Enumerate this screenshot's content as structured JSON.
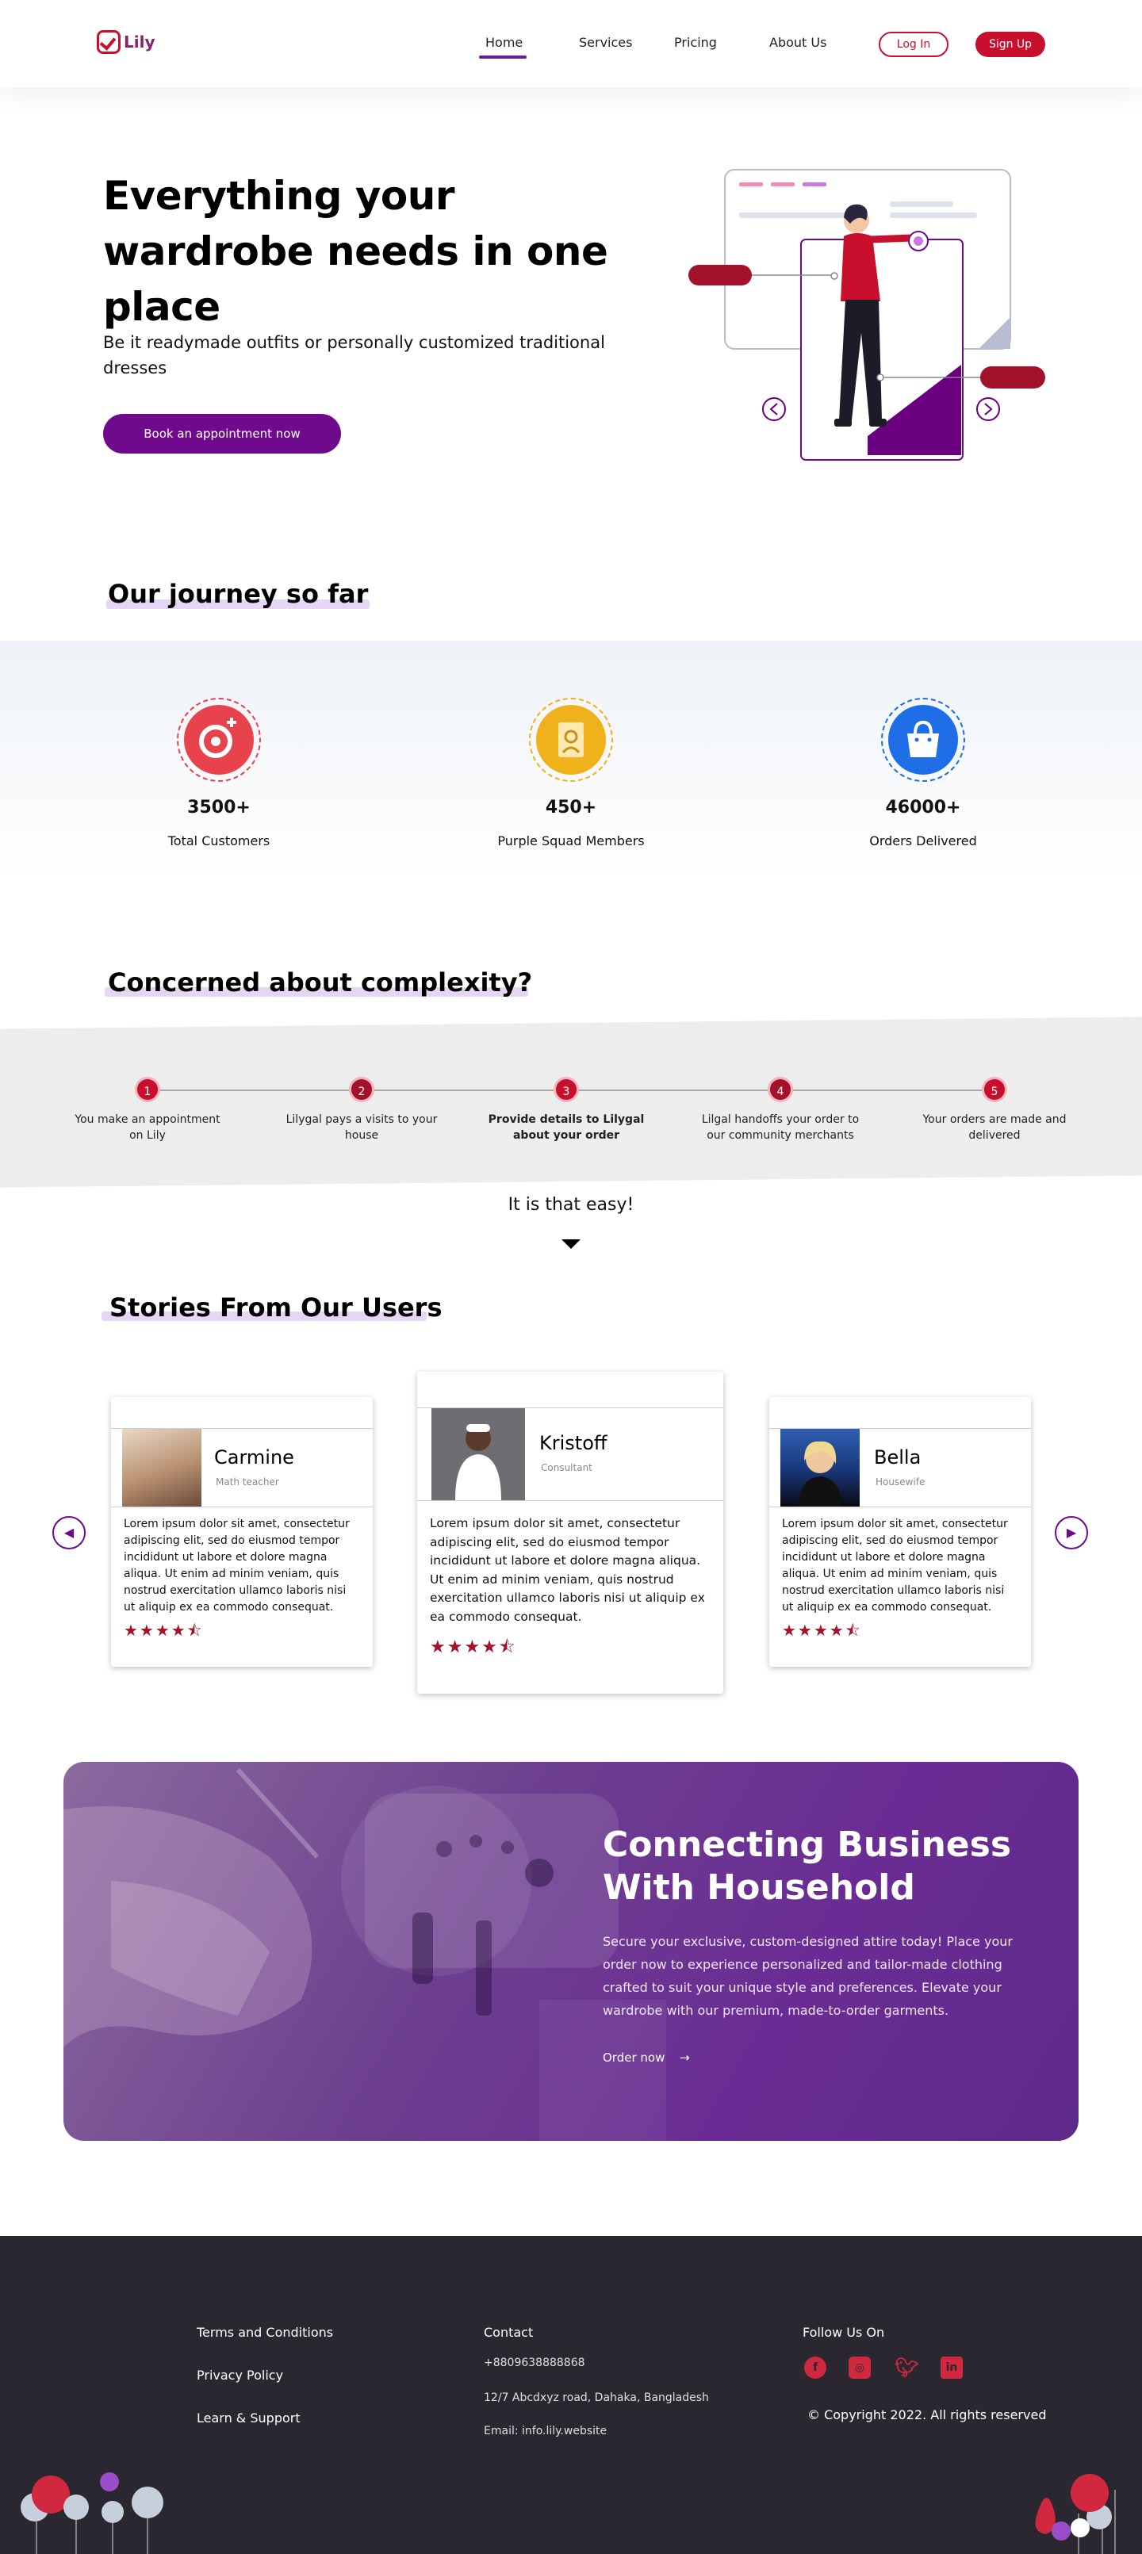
{
  "header": {
    "logo_text": "Lily",
    "nav": [
      "Home",
      "Services",
      "Pricing",
      "About Us"
    ],
    "login_label": "Log In",
    "signup_label": "Sign Up"
  },
  "hero": {
    "title": "Everything your wardrobe needs in one place",
    "subtitle": "Be it readymade outfits or personally customized traditional dresses",
    "cta_label": "Book an appointment now"
  },
  "journey": {
    "heading": "Our journey so far",
    "stats": [
      {
        "value": "3500+",
        "label": "Total Customers",
        "color": "#e8434d",
        "icon": "customer-plus-icon"
      },
      {
        "value": "450+",
        "label": "Purple Squad Members",
        "color": "#f0b21a",
        "icon": "badge-icon"
      },
      {
        "value": "46000+",
        "label": "Orders Delivered",
        "color": "#1f6ee8",
        "icon": "shopping-bag-icon"
      }
    ]
  },
  "complexity": {
    "heading": "Concerned about complexity?",
    "steps": [
      {
        "num": "1",
        "text": "You make an appointment on Lily"
      },
      {
        "num": "2",
        "text": "Lilygal pays a visits to your house"
      },
      {
        "num": "3",
        "text": "Provide details to Lilygal about your order"
      },
      {
        "num": "4",
        "text": "Lilgal handoffs your order to our community merchants"
      },
      {
        "num": "5",
        "text": "Your orders are made and delivered"
      }
    ],
    "easy_text": "It is that easy!"
  },
  "stories": {
    "heading": "Stories From Our Users",
    "cards": [
      {
        "name": "Carmine",
        "role": "Math teacher",
        "text": "Lorem ipsum dolor sit amet, consectetur adipiscing elit, sed do eiusmod tempor incididunt ut labore et dolore magna aliqua. Ut enim ad minim veniam, quis nostrud exercitation ullamco laboris nisi ut aliquip ex ea commodo consequat.",
        "rating": 4.5
      },
      {
        "name": "Kristoff",
        "role": "Consultant",
        "text": "Lorem ipsum dolor sit amet, consectetur adipiscing elit, sed do eiusmod tempor incididunt ut labore et dolore magna aliqua. Ut enim ad minim veniam, quis nostrud exercitation ullamco laboris nisi ut aliquip ex ea commodo consequat.",
        "rating": 4.5
      },
      {
        "name": "Bella",
        "role": "Housewife",
        "text": "Lorem ipsum dolor sit amet, consectetur adipiscing elit, sed do eiusmod tempor incididunt ut labore et dolore magna aliqua. Ut enim ad minim veniam, quis nostrud exercitation ullamco laboris nisi ut aliquip ex ea commodo consequat.",
        "rating": 4.5
      }
    ],
    "stars": "★★★★⯪"
  },
  "promo": {
    "title": "Connecting Business With Household",
    "text": "Secure your exclusive, custom-designed attire today! Place your order now to experience personalized and tailor-made clothing crafted to suit your unique style and preferences. Elevate your wardrobe with our premium, made-to-order garments.",
    "link_label": "Order now"
  },
  "footer": {
    "links": [
      "Terms and Conditions",
      "Privacy Policy",
      "Learn & Support"
    ],
    "contact_heading": "Contact",
    "phone": "+8809638888868",
    "address": "12/7 Abcdxyz road, Dahaka, Bangladesh",
    "email": "Email: info.lily.website",
    "follow_heading": "Follow Us On",
    "social": [
      "facebook-icon",
      "instagram-icon",
      "twitter-icon",
      "linkedin-icon"
    ],
    "copyright": "© Copyright 2022. All rights reserved"
  },
  "colors": {
    "primary": "#6f0a8c",
    "accent": "#c8102e",
    "footer_bg": "#2a2730"
  }
}
